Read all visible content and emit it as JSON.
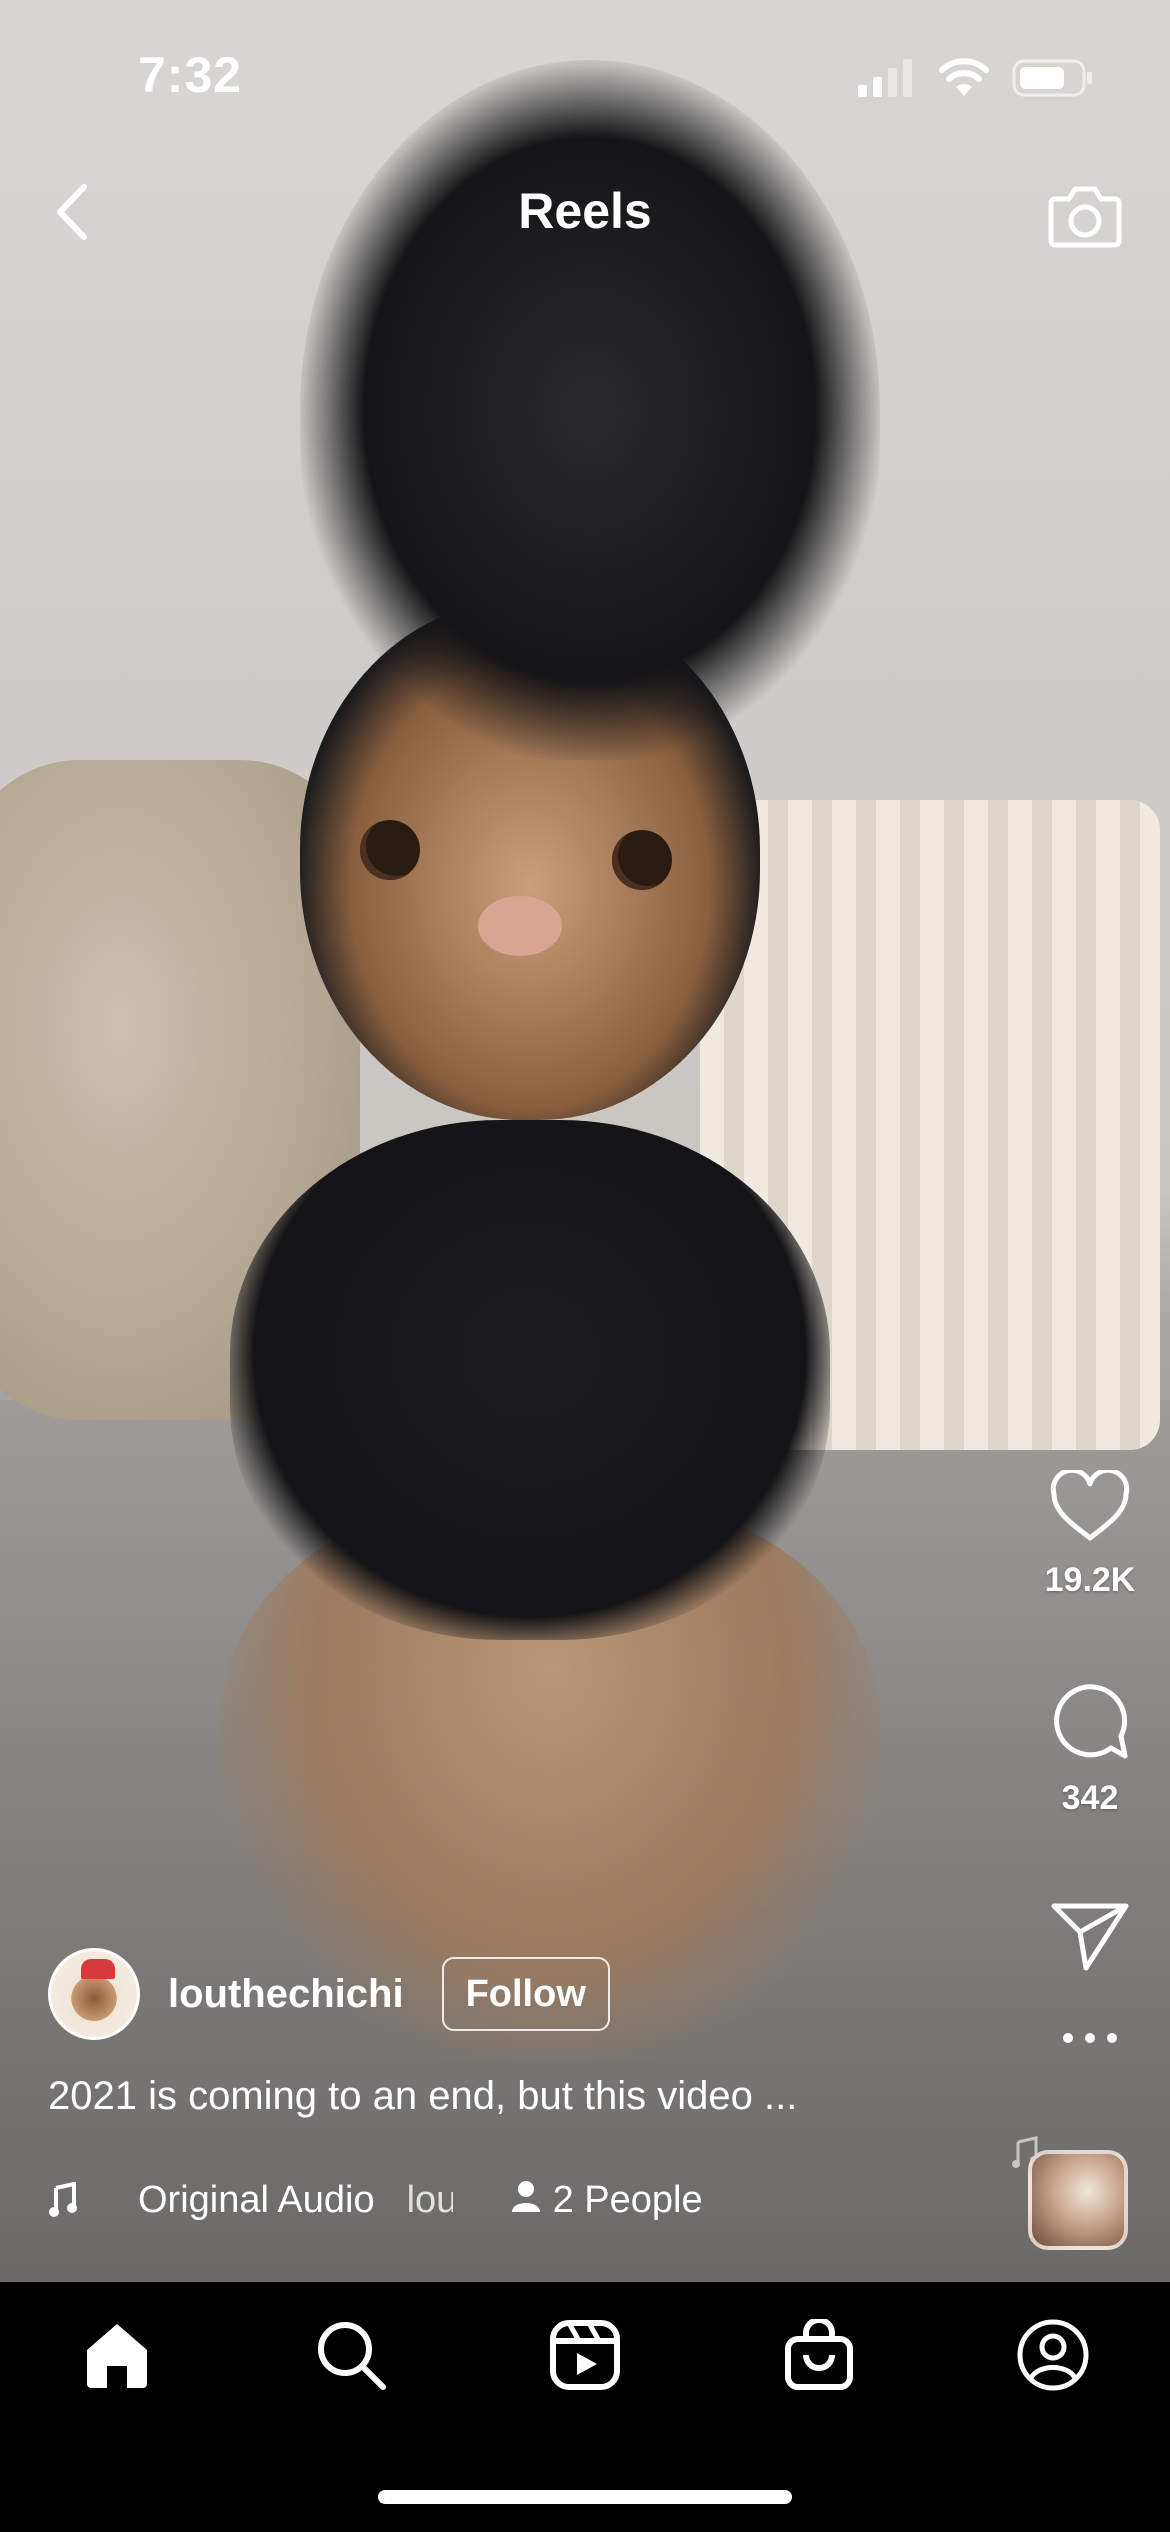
{
  "status_bar": {
    "time": "7:32",
    "icons": [
      "cellular-signal-icon",
      "wifi-icon",
      "battery-icon"
    ]
  },
  "header": {
    "title": "Reels",
    "icons": [
      "back-chevron-icon",
      "camera-icon"
    ]
  },
  "actions": {
    "likes": "19.2K",
    "comments": "342",
    "icons": [
      "heart-icon",
      "comment-icon",
      "share-icon",
      "more-icon"
    ]
  },
  "post": {
    "username": "louthechichi",
    "follow_label": "Follow",
    "caption": "2021 is coming to an end, but this video ...",
    "audio_label": "Original Audio",
    "audio_more": "lou",
    "people_label": "2 People"
  },
  "tab_bar": {
    "tabs": [
      "home-icon",
      "search-icon",
      "reels-icon",
      "shop-icon",
      "profile-icon"
    ]
  },
  "colors": {
    "background": "#000000",
    "text": "#ffffff"
  }
}
